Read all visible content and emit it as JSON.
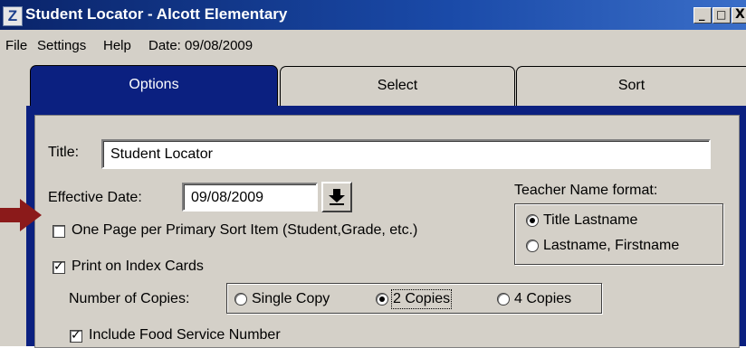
{
  "window": {
    "title": "Student Locator - Alcott Elementary",
    "icon": "z-app-icon",
    "buttons": {
      "minimize": "_",
      "maximize": "□",
      "close": "X"
    }
  },
  "menubar": {
    "file": "File",
    "settings": "Settings",
    "help": "Help",
    "date": "Date: 09/08/2009"
  },
  "tabs": [
    {
      "label": "Options",
      "active": true
    },
    {
      "label": "Select",
      "active": false
    },
    {
      "label": "Sort",
      "active": false
    }
  ],
  "form": {
    "title_label": "Title:",
    "title_value": "Student Locator",
    "effective_date_label": "Effective Date:",
    "effective_date_value": "09/08/2009",
    "one_page_label": "One Page per Primary Sort Item (Student,Grade, etc.)",
    "one_page_checked": false,
    "print_cards_label": "Print on Index Cards",
    "print_cards_checked": true,
    "copies_label": "Number of Copies:",
    "copies_options": [
      {
        "label": "Single Copy",
        "selected": false
      },
      {
        "label": "2 Copies",
        "selected": true
      },
      {
        "label": "4 Copies",
        "selected": false
      }
    ],
    "food_service_label": "Include Food Service Number",
    "food_service_checked": true
  },
  "teacher_format": {
    "heading": "Teacher Name format:",
    "options": [
      {
        "label": "Title Lastname",
        "selected": true
      },
      {
        "label": "Lastname, Firstname",
        "selected": false
      }
    ]
  },
  "colors": {
    "titlebar": "#0a246a",
    "active_tab": "#0b2080",
    "window_face": "#d4d0c8",
    "annotation_arrow": "#8b1a1a"
  }
}
